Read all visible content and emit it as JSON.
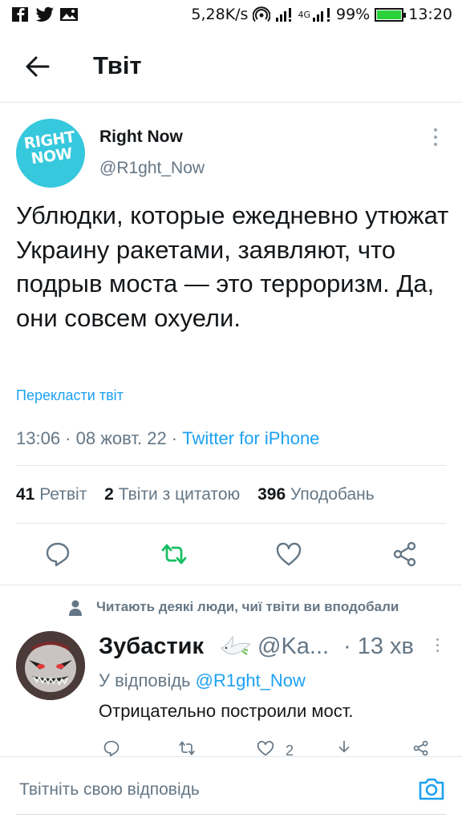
{
  "status_bar": {
    "speed": "5,28K/s",
    "network": "4G",
    "battery_percent": "99%",
    "battery_level": 0.99,
    "time": "13:20",
    "left_icons": [
      "facebook-icon",
      "twitter-icon",
      "gallery-icon"
    ]
  },
  "header": {
    "title": "Твіт"
  },
  "tweet": {
    "author_name": "Right Now",
    "author_handle": "@R1ght_Now",
    "avatar_text_line1": "RIGHT",
    "avatar_text_line2": "NOW",
    "text": "Ублюдки, которые ежедневно утюжат Украину ракетами, заявляют, что подрыв моста — это терроризм. Да, они совсем охуели.",
    "translate_label": "Перекласти твіт",
    "timestamp": "13:06 · 08 жовт. 22 · ",
    "source": "Twitter for iPhone",
    "retweets_count": "41",
    "retweets_label": "Ретвіт",
    "quotes_count": "2",
    "quotes_label": "Твіти з цитатою",
    "likes_count": "396",
    "likes_label": "Уподобань"
  },
  "reply_context": {
    "label": "Читають деякі люди, чиї твіти ви вподобали"
  },
  "reply": {
    "author_name": "Зубастик",
    "author_handle": "@Ka...",
    "time": "· 13 хв",
    "replying_to_prefix": "У відповідь ",
    "replying_to": "@R1ght_Now",
    "text": "Отрицательно построили мост.",
    "likes_count": "2"
  },
  "compose": {
    "placeholder": "Твітніть свою відповідь"
  },
  "colors": {
    "accent": "#1da1f2",
    "retweet_green": "#17bf63",
    "muted": "#657786",
    "avatar_bg": "#36c8dd"
  }
}
